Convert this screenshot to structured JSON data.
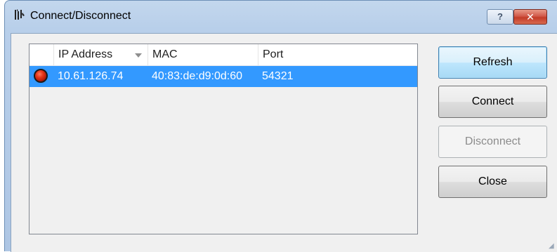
{
  "window": {
    "title": "Connect/Disconnect",
    "app_icon": "zebra-app-icon",
    "help_glyph": "?",
    "close_glyph": "✕"
  },
  "list": {
    "columns": [
      "",
      "IP Address",
      "MAC",
      "Port"
    ],
    "sorted_column": "IP Address",
    "rows": [
      {
        "status_icon": "red-status-dot-icon",
        "ip": "10.61.126.74",
        "mac": "40:83:de:d9:0d:60",
        "port": "54321",
        "selected": true
      }
    ]
  },
  "buttons": {
    "refresh": "Refresh",
    "connect": "Connect",
    "disconnect": "Disconnect",
    "close": "Close"
  },
  "colors": {
    "selection": "#3399ff",
    "close_button": "#c33b28",
    "status_dot": "#e4361a"
  }
}
